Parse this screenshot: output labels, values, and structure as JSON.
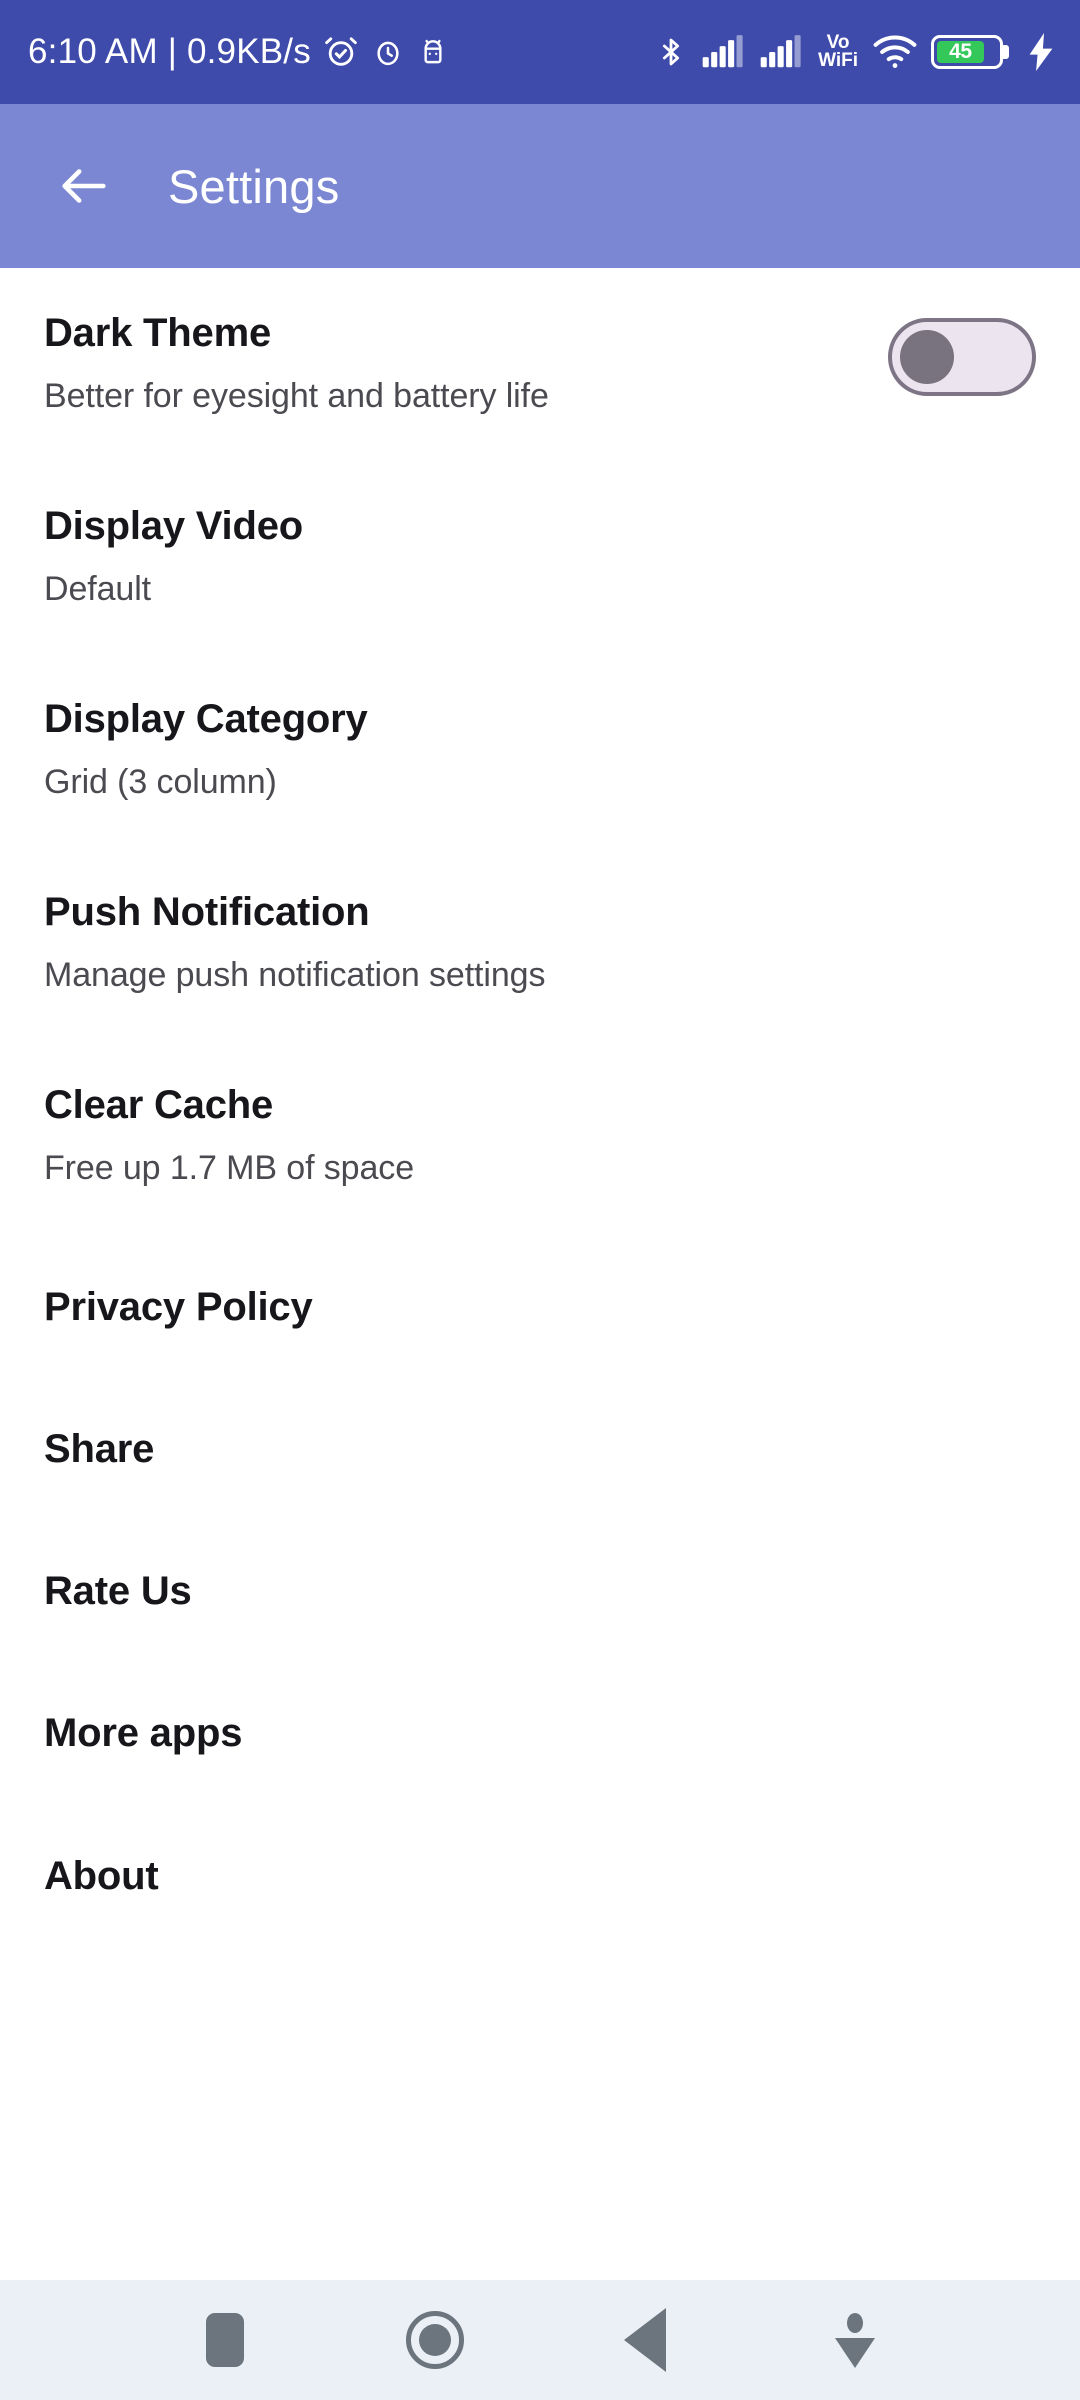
{
  "status_bar": {
    "clock": "6:10 AM | 0.9KB/s",
    "battery_level": "45",
    "vowifi_top": "Vo",
    "vowifi_bottom": "WiFi",
    "icons": [
      "alarm-set-icon",
      "alarm-icon",
      "android-debug-icon",
      "bluetooth-icon",
      "signal-sim1-icon",
      "signal-sim2-icon",
      "vowifi-icon",
      "wifi-icon",
      "battery-icon",
      "charging-bolt-icon"
    ],
    "background_color": "#3f4bab",
    "battery_fill_color": "#34c759"
  },
  "app_bar": {
    "title": "Settings",
    "back_icon": "arrow-left-icon",
    "background_color": "#7b87d2",
    "text_color": "#ffffff"
  },
  "settings": {
    "items": [
      {
        "title": "Dark Theme",
        "subtitle": "Better for eyesight and battery life",
        "control": "toggle",
        "toggle_on": false
      },
      {
        "title": "Display Video",
        "subtitle": "Default",
        "control": "none"
      },
      {
        "title": "Display Category",
        "subtitle": "Grid (3 column)",
        "control": "none"
      },
      {
        "title": "Push Notification",
        "subtitle": "Manage push notification settings",
        "control": "none"
      },
      {
        "title": "Clear Cache",
        "subtitle": "Free up 1.7 MB of space",
        "control": "none"
      },
      {
        "title": "Privacy Policy",
        "subtitle": "",
        "control": "none"
      },
      {
        "title": "Share",
        "subtitle": "",
        "control": "none"
      },
      {
        "title": "Rate Us",
        "subtitle": "",
        "control": "none"
      },
      {
        "title": "More apps",
        "subtitle": "",
        "control": "none"
      },
      {
        "title": "About",
        "subtitle": "",
        "control": "none"
      }
    ],
    "toggle_track_color": "#ece5ef",
    "toggle_thumb_color": "#79727f",
    "title_color": "#17161a",
    "subtitle_color": "#4a4a50"
  },
  "nav_bar": {
    "buttons": [
      "recents-button",
      "home-button",
      "back-button",
      "hide-navbar-button"
    ],
    "background_color": "#eaf0f6",
    "icon_color": "#6c757d"
  }
}
